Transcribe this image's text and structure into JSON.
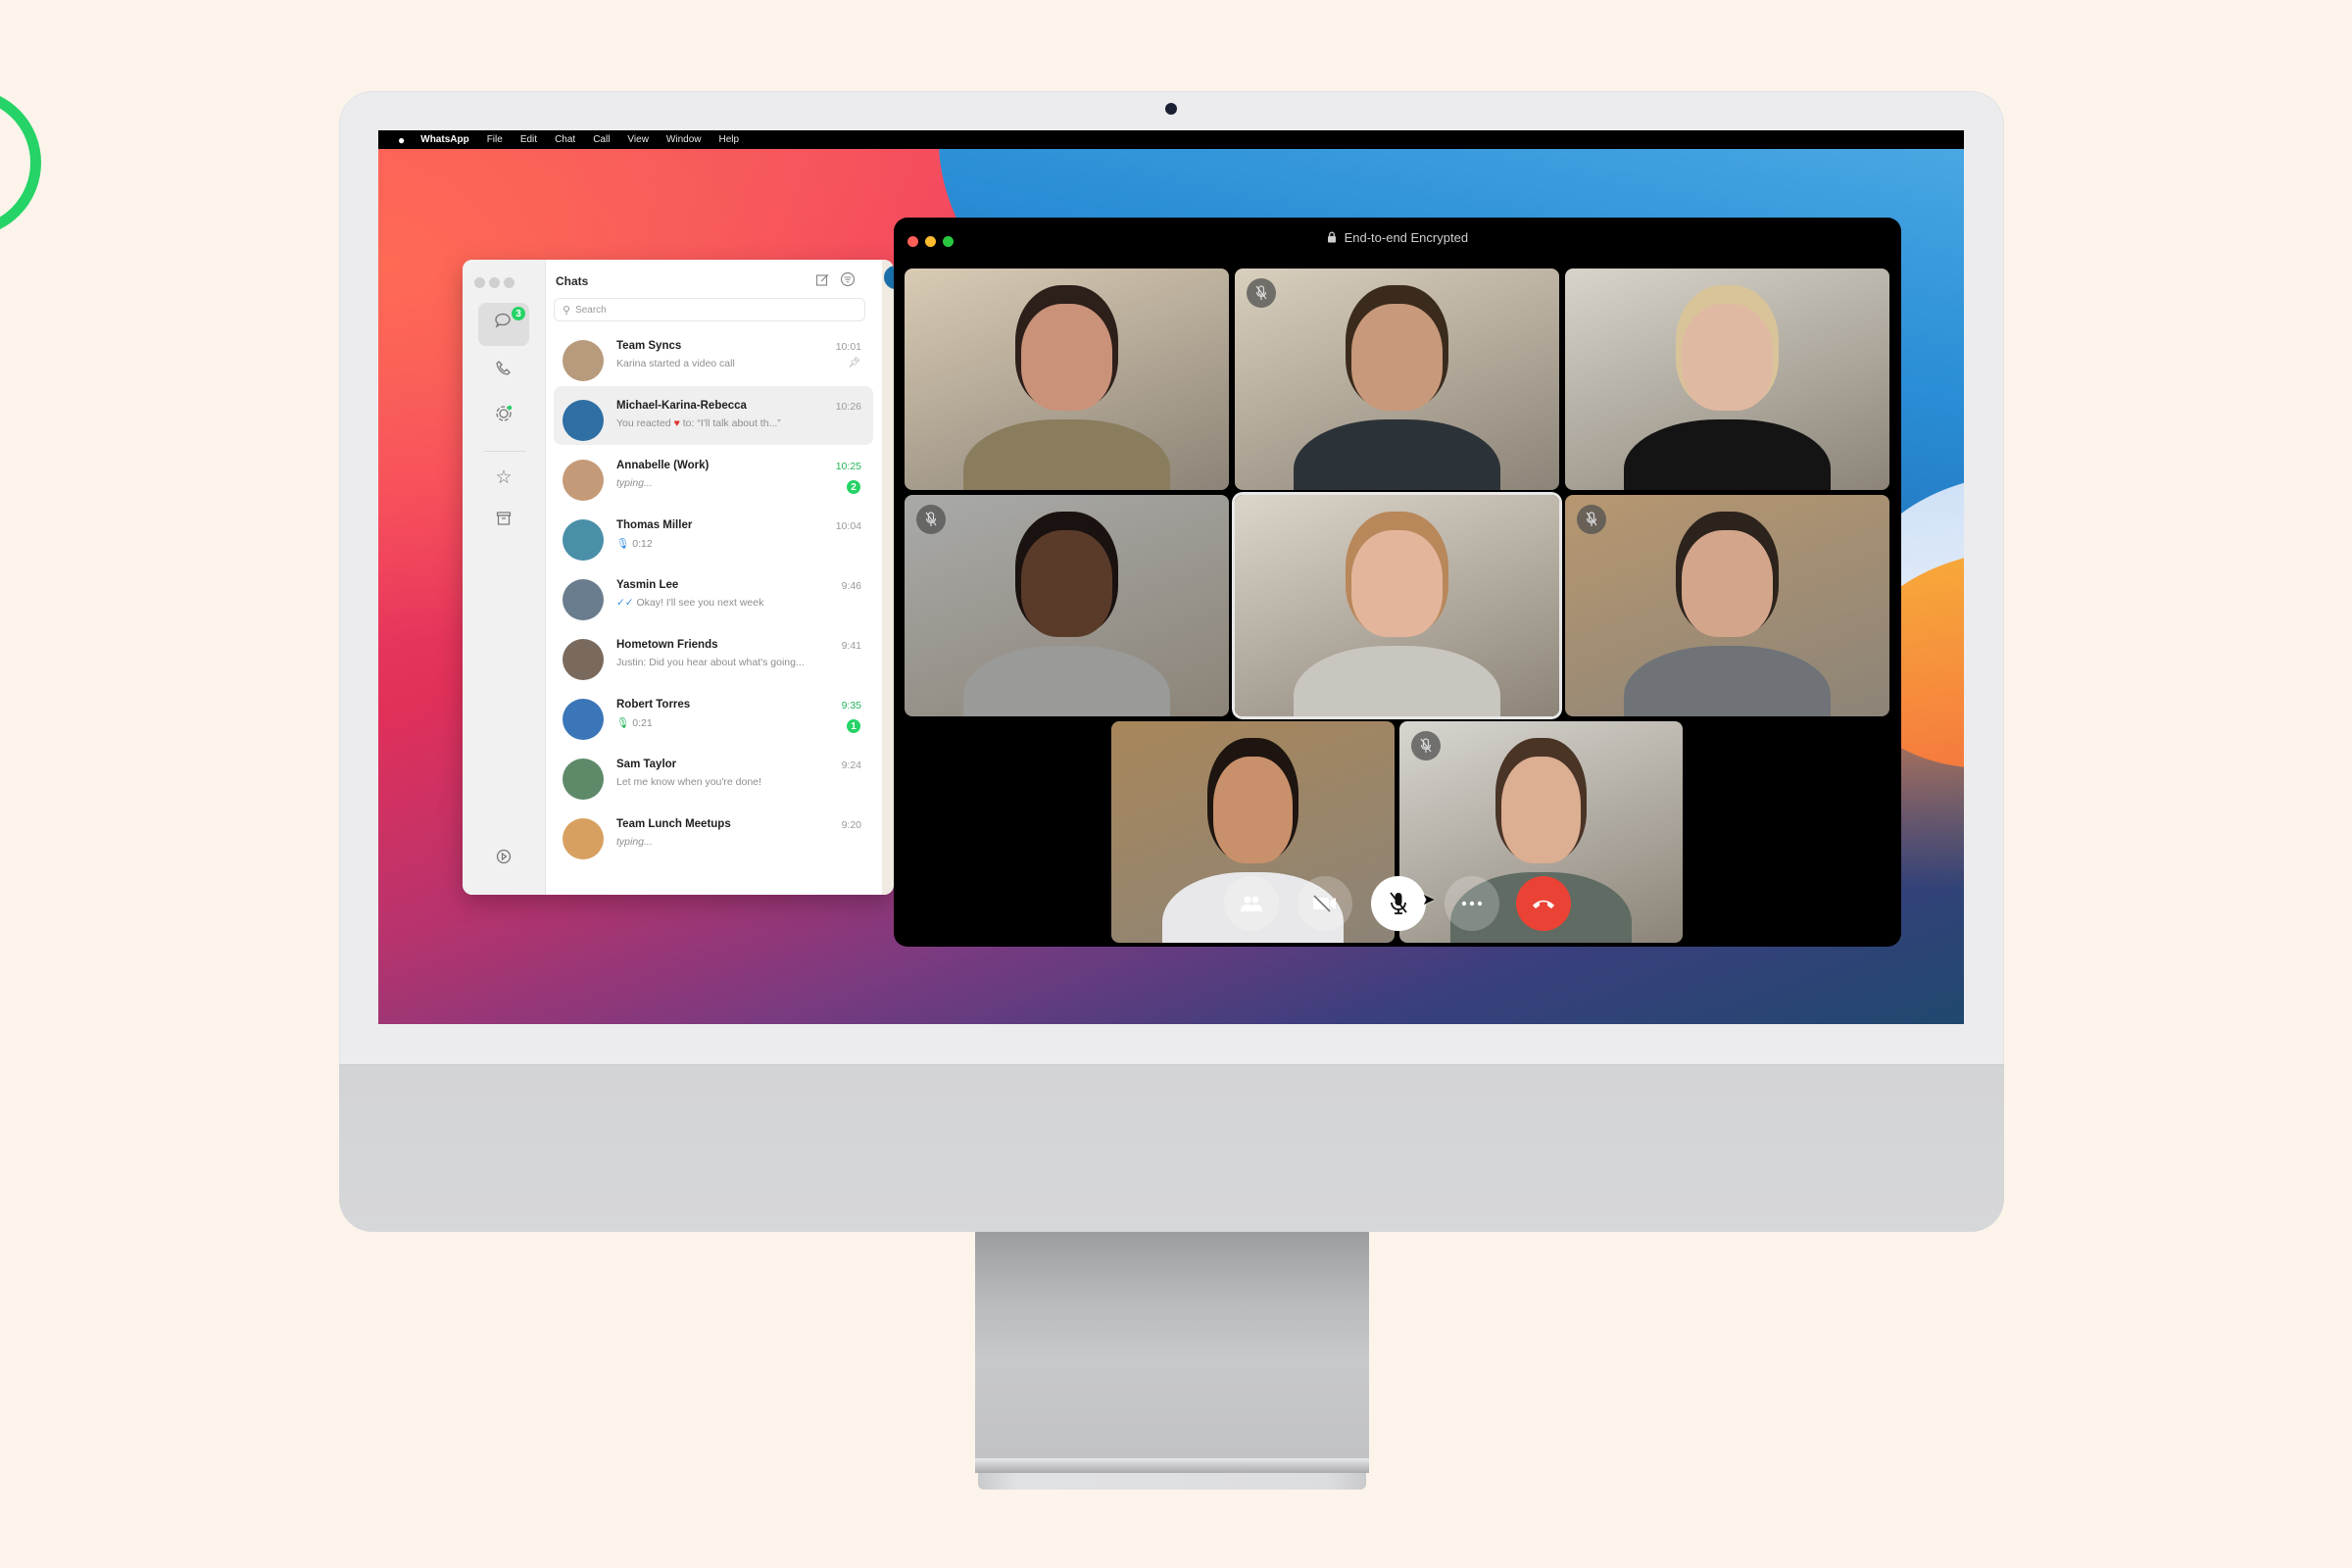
{
  "menubar": {
    "apple": "",
    "items": [
      "WhatsApp",
      "File",
      "Edit",
      "Chat",
      "Call",
      "View",
      "Window",
      "Help"
    ]
  },
  "chat_window": {
    "title": "Chats",
    "new_chat_icon": "compose-icon",
    "filter_icon": "filter-icon",
    "search_placeholder": "Search",
    "nav": {
      "chats_badge": "3",
      "items": [
        "chats",
        "calls",
        "status",
        "starred",
        "archived",
        "settings"
      ]
    },
    "chats": [
      {
        "name": "Team Syncs",
        "preview": "Karina started a video call",
        "time": "10:01",
        "pinned": true,
        "avatar_color": "#b89a7c"
      },
      {
        "name": "Michael-Karina-Rebecca",
        "preview_prefix": "You reacted",
        "preview_emoji": "♥",
        "preview_suffix": "to: “I'll talk about th...”",
        "time": "10:26",
        "selected": true,
        "avatar_color": "#2f6fa3"
      },
      {
        "name": "Annabelle (Work)",
        "preview": "typing...",
        "time": "10:25",
        "unread": "2",
        "typing": true,
        "avatar_color": "#c49a78"
      },
      {
        "name": "Thomas Miller",
        "preview": "0:12",
        "time": "10:04",
        "voice": "blue",
        "avatar_color": "#4a8fa8"
      },
      {
        "name": "Yasmin Lee",
        "preview": "Okay! I'll see you next week",
        "time": "9:46",
        "read_ticks": true,
        "avatar_color": "#6a7d8e"
      },
      {
        "name": "Hometown Friends",
        "preview": "Justin: Did you hear about what's going...",
        "time": "9:41",
        "avatar_color": "#7a6a5e"
      },
      {
        "name": "Robert Torres",
        "preview": "0:21",
        "time": "9:35",
        "unread": "1",
        "voice": "green",
        "avatar_color": "#3b76b8"
      },
      {
        "name": "Sam Taylor",
        "preview": "Let me know when you're done!",
        "time": "9:24",
        "avatar_color": "#5e8a6a"
      },
      {
        "name": "Team Lunch Meetups",
        "preview": "typing...",
        "time": "9:20",
        "typing": true,
        "avatar_color": "#d8a060"
      }
    ]
  },
  "call_window": {
    "title": "End-to-end Encrypted",
    "lock_icon": "lock-icon",
    "participants": [
      {
        "id": 1,
        "muted": false,
        "bg": "#d9cbb4",
        "skin": "#c99279",
        "hair": "#2d1f1a",
        "shirt": "#8a7d5e"
      },
      {
        "id": 2,
        "muted": true,
        "bg": "#d8cfbd",
        "skin": "#c8997a",
        "hair": "#3a2b1d",
        "shirt": "#2c3338"
      },
      {
        "id": 3,
        "muted": false,
        "bg": "#d7d4cb",
        "skin": "#e0b9a2",
        "hair": "#d9c49a",
        "shirt": "#141414"
      },
      {
        "id": 4,
        "muted": true,
        "bg": "#a9aaa8",
        "skin": "#5a3b2a",
        "hair": "#1a1210",
        "shirt": "#9a9a98"
      },
      {
        "id": 5,
        "muted": false,
        "active_speaker": true,
        "bg": "#dcd5ca",
        "skin": "#e3b69c",
        "hair": "#b8875a",
        "shirt": "#c9c5bf"
      },
      {
        "id": 6,
        "muted": true,
        "bg": "#b79770",
        "skin": "#d3a58a",
        "hair": "#2c231c",
        "shirt": "#6f7378"
      },
      {
        "id": 7,
        "muted": false,
        "bg": "#a8865a",
        "skin": "#c9906c",
        "hair": "#1e1510",
        "shirt": "#e8e8ea"
      },
      {
        "id": 8,
        "muted": true,
        "bg": "#d8d6d0",
        "skin": "#dcae92",
        "hair": "#4a3426",
        "shirt": "#5f6b63"
      }
    ],
    "controls": [
      {
        "name": "participants",
        "icon": "participants-icon",
        "glyph": "👥",
        "style": "translucent"
      },
      {
        "name": "video-off",
        "icon": "video-off-icon",
        "glyph": "⊘",
        "style": "translucent"
      },
      {
        "name": "mute",
        "icon": "mic-off-icon",
        "glyph": "🎙",
        "style": "white"
      },
      {
        "name": "more",
        "icon": "more-icon",
        "glyph": "•••",
        "style": "translucent"
      },
      {
        "name": "end-call",
        "icon": "end-call-icon",
        "glyph": "☎",
        "style": "red"
      }
    ]
  },
  "colors": {
    "whatsapp_green": "#25d366",
    "end_call_red": "#ea4335",
    "traffic_red": "#fe5f57",
    "traffic_yellow": "#febc2e",
    "traffic_green": "#28c840",
    "page_bg": "#fcf4ea"
  }
}
